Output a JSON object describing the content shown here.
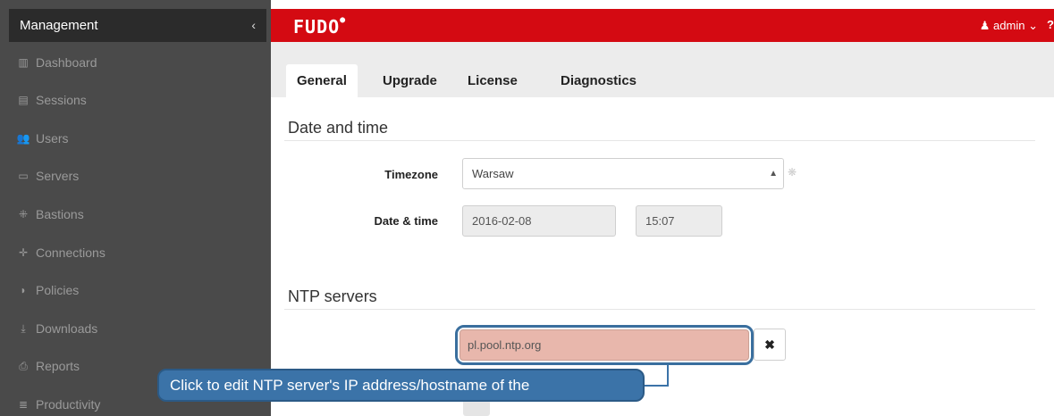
{
  "sidebar": {
    "title": "Management",
    "collapse_glyph": "‹",
    "items": [
      {
        "label": "Dashboard",
        "icon": "dashboard-icon",
        "glyph": "▥"
      },
      {
        "label": "Sessions",
        "icon": "sessions-icon",
        "glyph": "▤"
      },
      {
        "label": "Users",
        "icon": "users-icon",
        "glyph": "👥"
      },
      {
        "label": "Servers",
        "icon": "servers-icon",
        "glyph": "▭"
      },
      {
        "label": "Bastions",
        "icon": "bastions-icon",
        "glyph": "⁜"
      },
      {
        "label": "Connections",
        "icon": "connections-icon",
        "glyph": "✛"
      },
      {
        "label": "Policies",
        "icon": "policies-icon",
        "glyph": "◗"
      },
      {
        "label": "Downloads",
        "icon": "downloads-icon",
        "glyph": "⤓"
      },
      {
        "label": "Reports",
        "icon": "reports-icon",
        "glyph": "⎙"
      },
      {
        "label": "Productivity",
        "icon": "productivity-icon",
        "glyph": "≣"
      }
    ]
  },
  "topbar": {
    "logo": "FUDO",
    "user_label": "admin",
    "user_icon": "user-icon",
    "help_glyph": "?",
    "brand_color": "#d40a12"
  },
  "tabs": [
    {
      "label": "General",
      "active": true
    },
    {
      "label": "Upgrade",
      "active": false
    },
    {
      "label": "License",
      "active": false
    },
    {
      "label": "Diagnostics",
      "active": false
    }
  ],
  "date_time": {
    "section_title": "Date and time",
    "timezone_label": "Timezone",
    "timezone_value": "Warsaw",
    "datetime_label": "Date & time",
    "date_value": "2016-02-08",
    "time_value": "15:07"
  },
  "ntp": {
    "section_title": "NTP servers",
    "server_value": "pl.pool.ntp.org",
    "remove_glyph": "✖"
  },
  "callout": {
    "text": "Click to edit NTP server's IP address/hostname of the"
  }
}
